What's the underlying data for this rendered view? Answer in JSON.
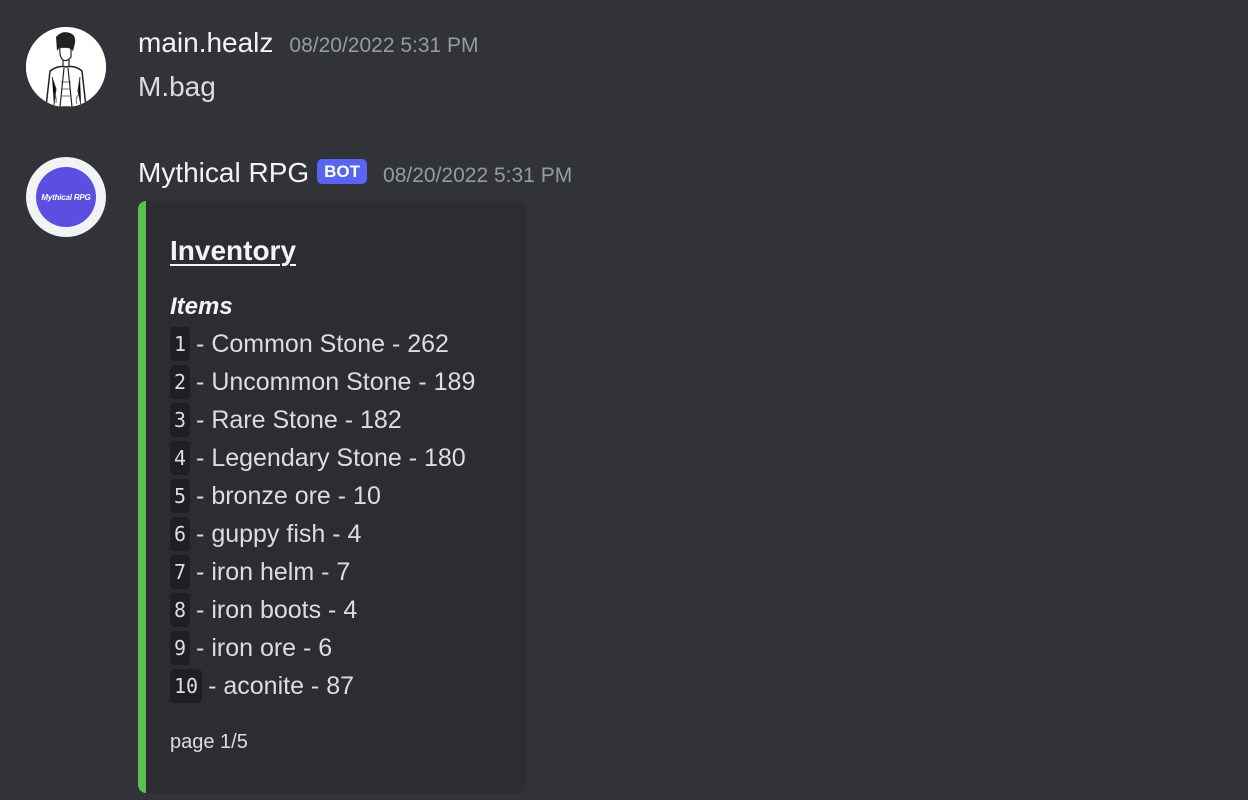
{
  "messages": [
    {
      "username": "main.healz",
      "timestamp": "08/20/2022 5:31 PM",
      "content": "M.bag",
      "avatar_icon": "user-avatar-sketch"
    },
    {
      "username": "Mythical RPG",
      "bot_tag": "BOT",
      "timestamp": "08/20/2022 5:31 PM",
      "avatar_text": "Mythical RPG",
      "embed": {
        "accent_color": "#59c24f",
        "title": "Inventory",
        "field_name": "Items",
        "items": [
          {
            "num": "1",
            "text": "- Common Stone - 262"
          },
          {
            "num": "2",
            "text": "- Uncommon Stone - 189"
          },
          {
            "num": "3",
            "text": "- Rare Stone - 182"
          },
          {
            "num": "4",
            "text": "- Legendary Stone - 180"
          },
          {
            "num": "5",
            "text": "- bronze ore - 10"
          },
          {
            "num": "6",
            "text": "- guppy fish - 4"
          },
          {
            "num": "7",
            "text": "- iron helm - 7"
          },
          {
            "num": "8",
            "text": "- iron boots - 4"
          },
          {
            "num": "9",
            "text": "- iron ore - 6"
          },
          {
            "num": "10",
            "text": "- aconite - 87"
          }
        ],
        "footer": "page 1/5"
      }
    }
  ],
  "colors": {
    "background": "#313338",
    "embed_background": "#2b2d31",
    "bot_tag": "#5865f2",
    "bot_avatar": "#5a4fe0",
    "timestamp": "#949ba4"
  }
}
